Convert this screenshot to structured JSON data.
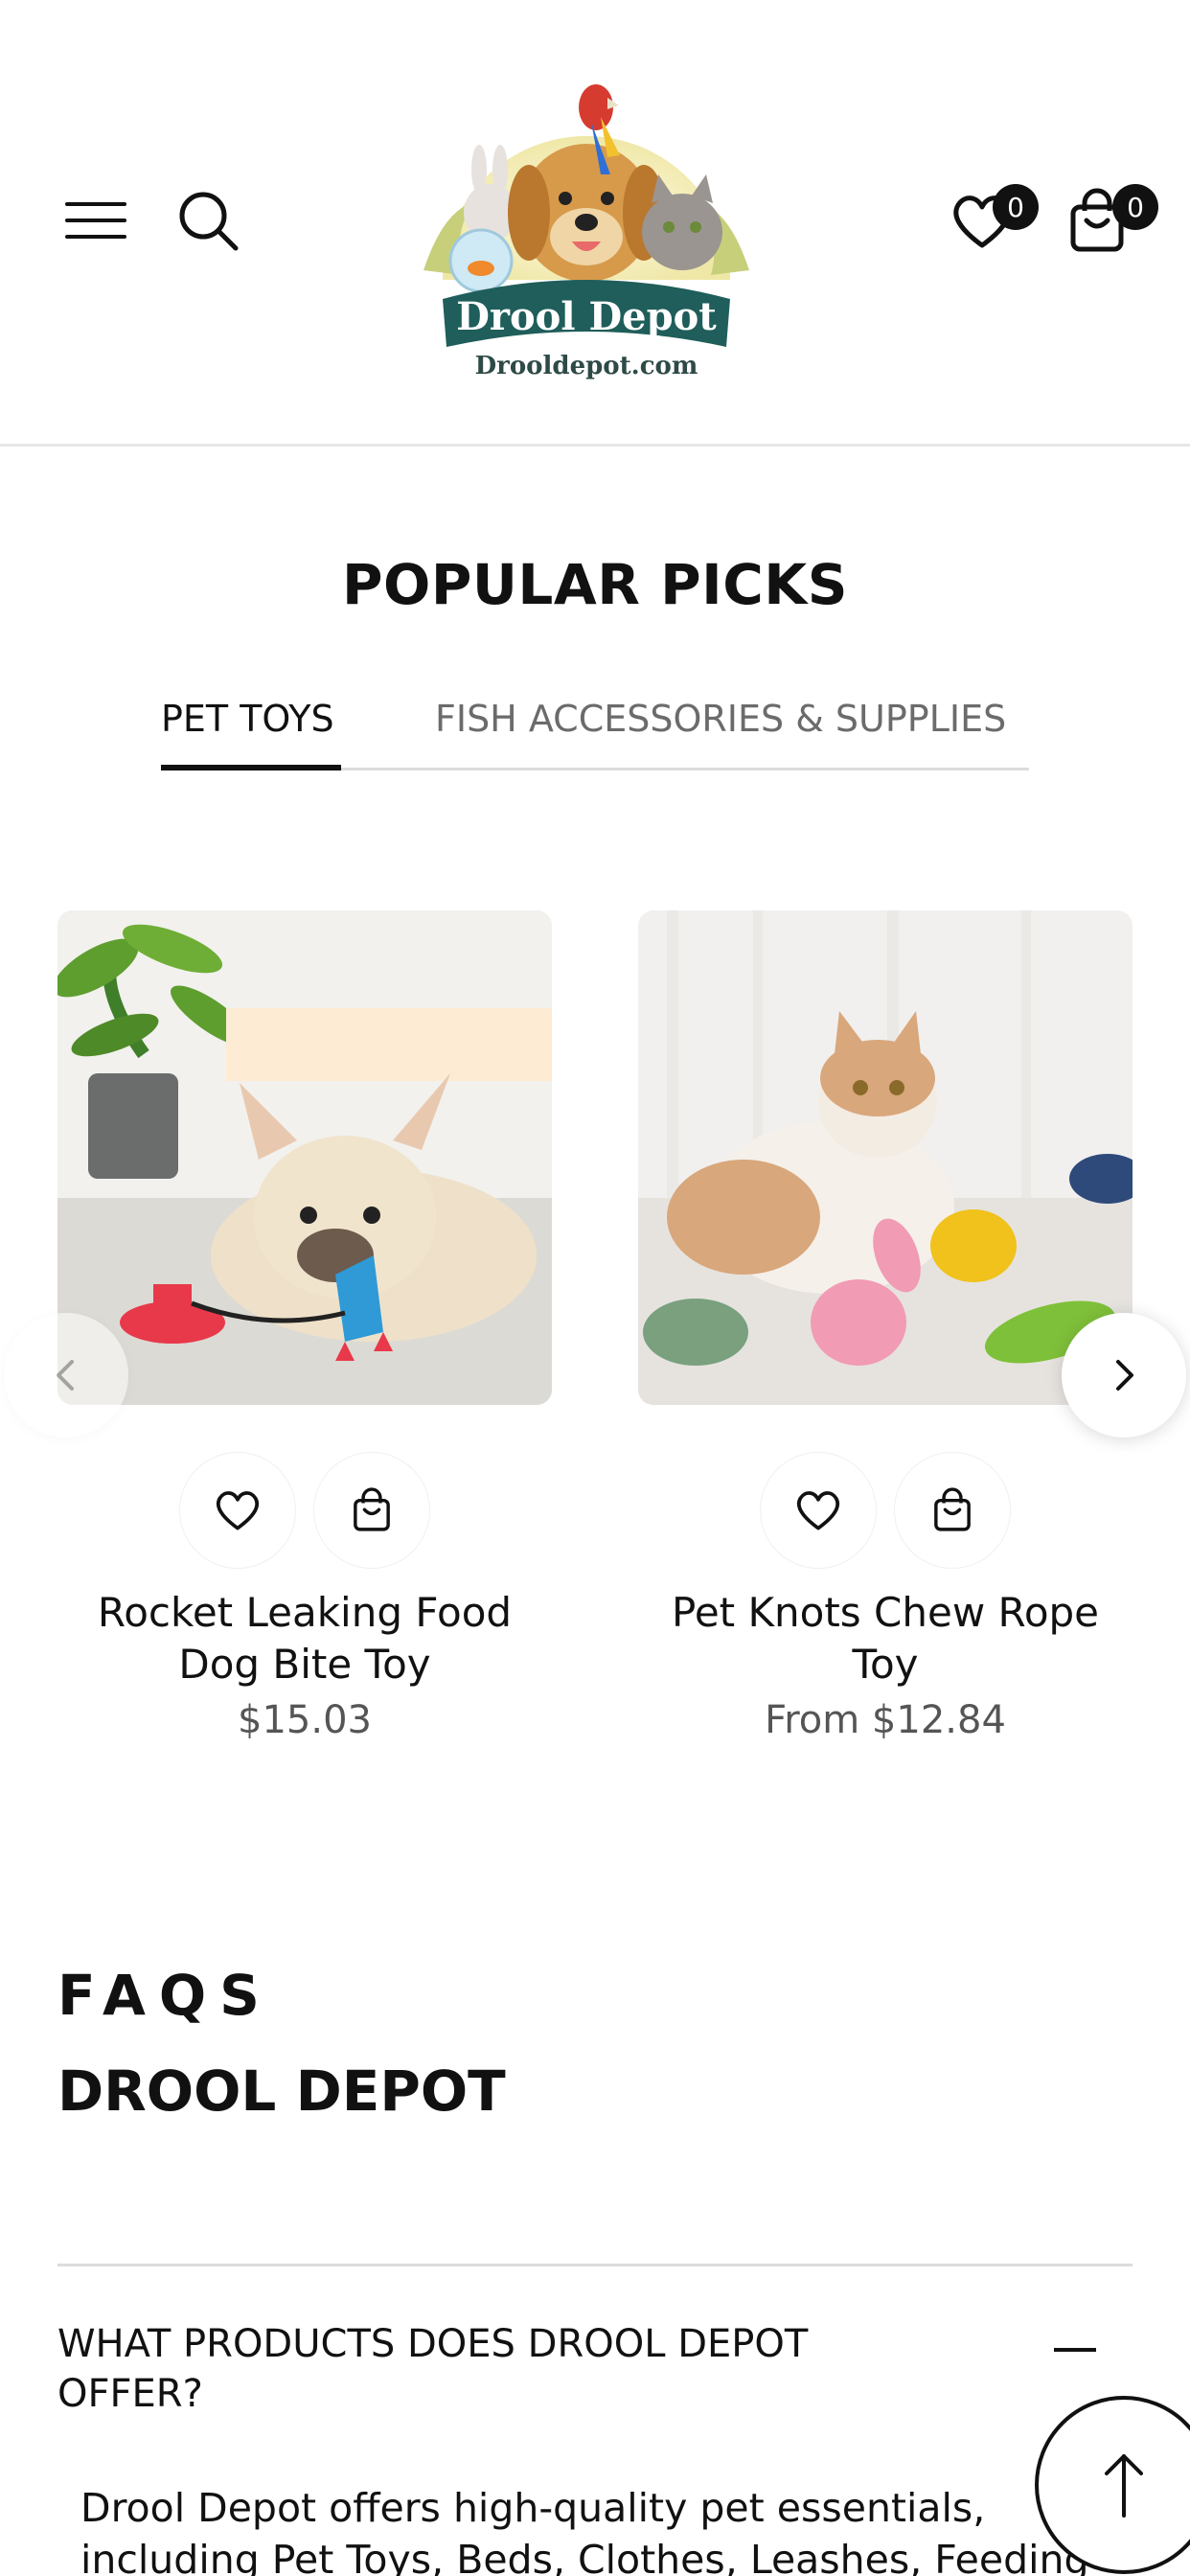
{
  "header": {
    "menu_icon": "hamburger-menu-icon",
    "search_icon": "search-icon",
    "logo": {
      "brand": "Drool Depot",
      "domain": "Drooldepot.com"
    },
    "wishlist": {
      "icon": "heart-icon",
      "count": "0"
    },
    "cart": {
      "icon": "shopping-bag-icon",
      "count": "0"
    }
  },
  "popular": {
    "title": "POPULAR PICKS",
    "tabs": [
      {
        "label": "PET TOYS",
        "active": true
      },
      {
        "label": "FISH ACCESSORIES & SUPPLIES",
        "active": false
      }
    ],
    "products": [
      {
        "name": "Rocket Leaking Food Dog Bite Toy",
        "price": "$15.03"
      },
      {
        "name": "Pet Knots Chew Rope Toy",
        "price": "From $12.84"
      }
    ]
  },
  "faq": {
    "eyebrow": "FAQS",
    "title": "DROOL DEPOT",
    "items": [
      {
        "question": "WHAT PRODUCTS DOES DROOL DEPOT OFFER?",
        "answer": "Drool Depot offers high-quality pet essentials, including Pet Toys, Beds, Clothes, Leashes, Feeding"
      }
    ]
  },
  "colors": {
    "text": "#111111",
    "muted": "#6b6b6b",
    "divider": "#dcdcdc"
  }
}
